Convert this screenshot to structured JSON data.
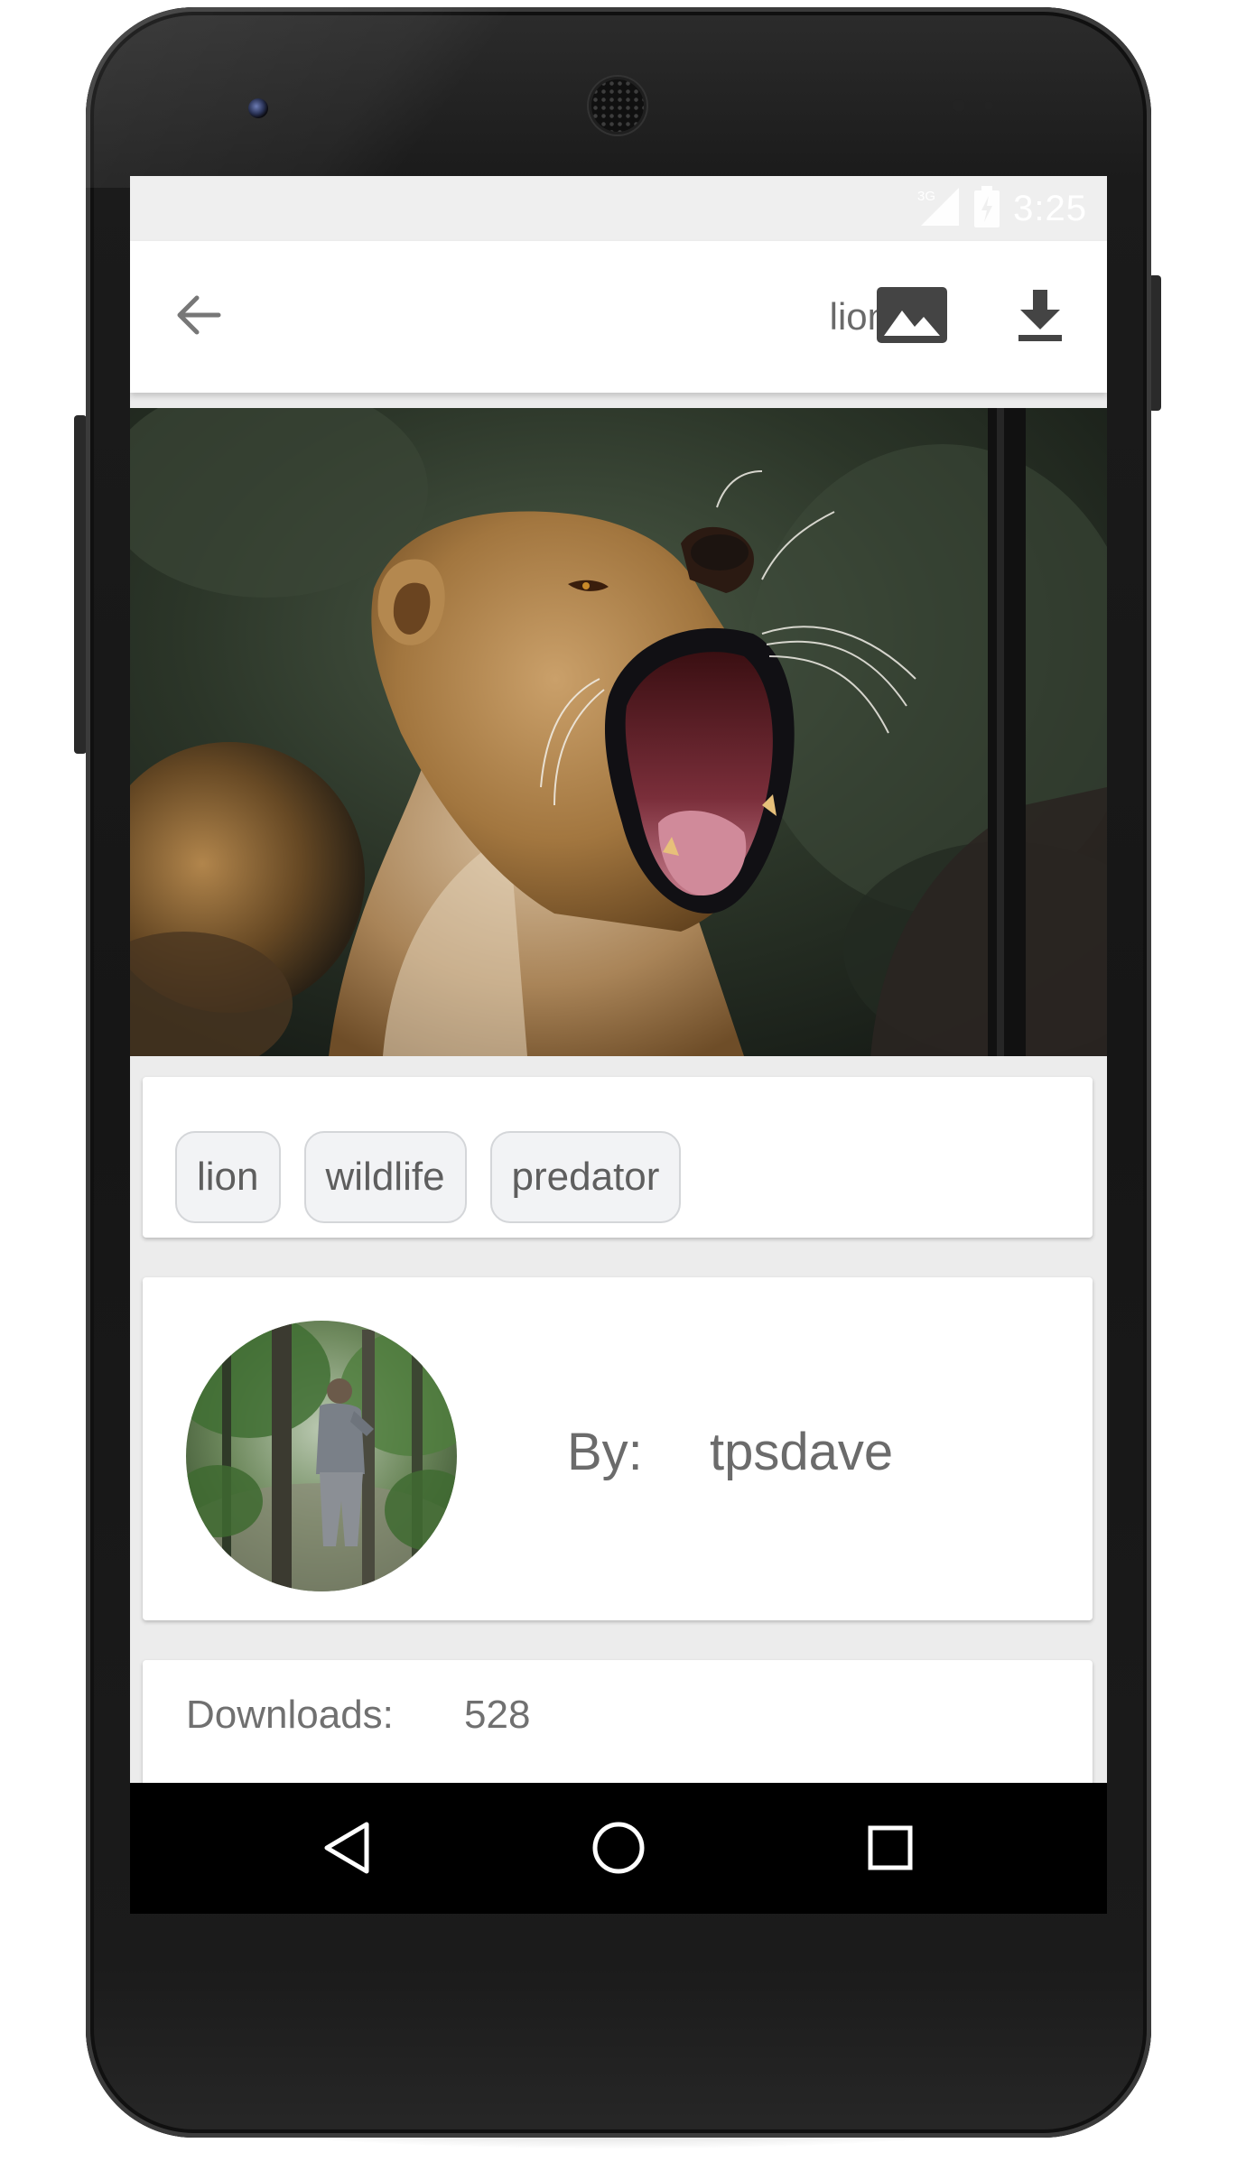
{
  "status_bar": {
    "network": "3G",
    "time": "3:25"
  },
  "app_bar": {
    "back_icon": "arrow-back-icon",
    "title": "lion",
    "wallpaper_icon": "image-icon",
    "download_icon": "download-icon"
  },
  "tags": [
    "lion",
    "wildlife",
    "predator"
  ],
  "author": {
    "by_label": "By:",
    "name": "tpsdave"
  },
  "stats": {
    "downloads_label": "Downloads:",
    "downloads_value": "528"
  },
  "nav_bar": {
    "back_icon": "nav-back-icon",
    "home_icon": "nav-home-icon",
    "recents_icon": "nav-recents-icon"
  },
  "colors": {
    "app_bar": "#ffffff",
    "screen_background": "#ececec",
    "chip_background": "#f2f3f5",
    "chip_border": "#d4d6d9",
    "text_secondary": "#6b6b6b",
    "nav_bar": "#000000"
  }
}
